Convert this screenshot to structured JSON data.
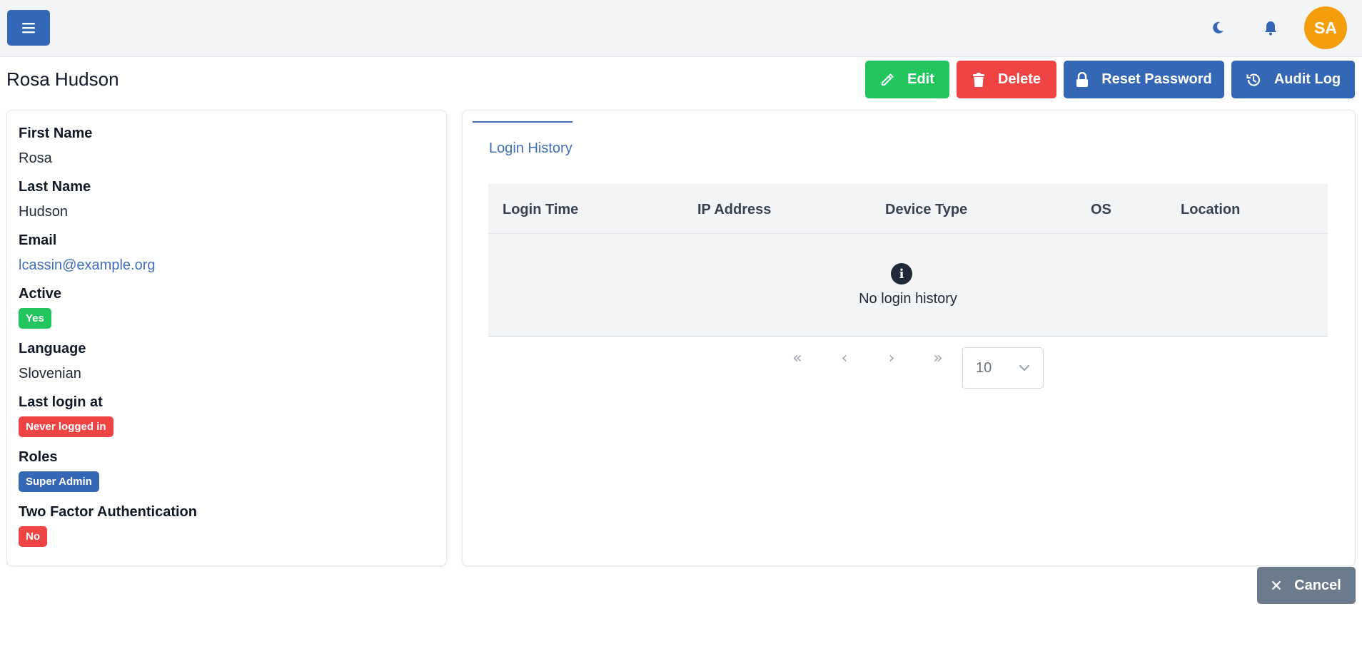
{
  "header": {
    "avatar_initials": "SA",
    "menu_icon": "hamburger-icon",
    "theme_icon": "moon-icon",
    "notifications_icon": "bell-icon"
  },
  "page": {
    "title": "Rosa Hudson"
  },
  "actions": {
    "edit_label": "Edit",
    "delete_label": "Delete",
    "reset_password_label": "Reset Password",
    "audit_log_label": "Audit Log",
    "cancel_label": "Cancel"
  },
  "details": {
    "first_name_label": "First Name",
    "first_name": "Rosa",
    "last_name_label": "Last Name",
    "last_name": "Hudson",
    "email_label": "Email",
    "email": "lcassin@example.org",
    "active_label": "Active",
    "active": "Yes",
    "language_label": "Language",
    "language": "Slovenian",
    "last_login_label": "Last login at",
    "last_login": "Never logged in",
    "roles_label": "Roles",
    "roles": [
      "Super Admin"
    ],
    "two_factor_label": "Two Factor Authentication",
    "two_factor": "No"
  },
  "login_history": {
    "tab_label": "Login History",
    "columns": [
      "Login Time",
      "IP Address",
      "Device Type",
      "OS",
      "Location"
    ],
    "rows": [],
    "empty_text": "No login history",
    "page_size": "10"
  },
  "colors": {
    "primary": "#3568b4",
    "success": "#22c55e",
    "danger": "#ef4444",
    "avatar": "#f59e0b",
    "secondary": "#6b7b8c"
  }
}
